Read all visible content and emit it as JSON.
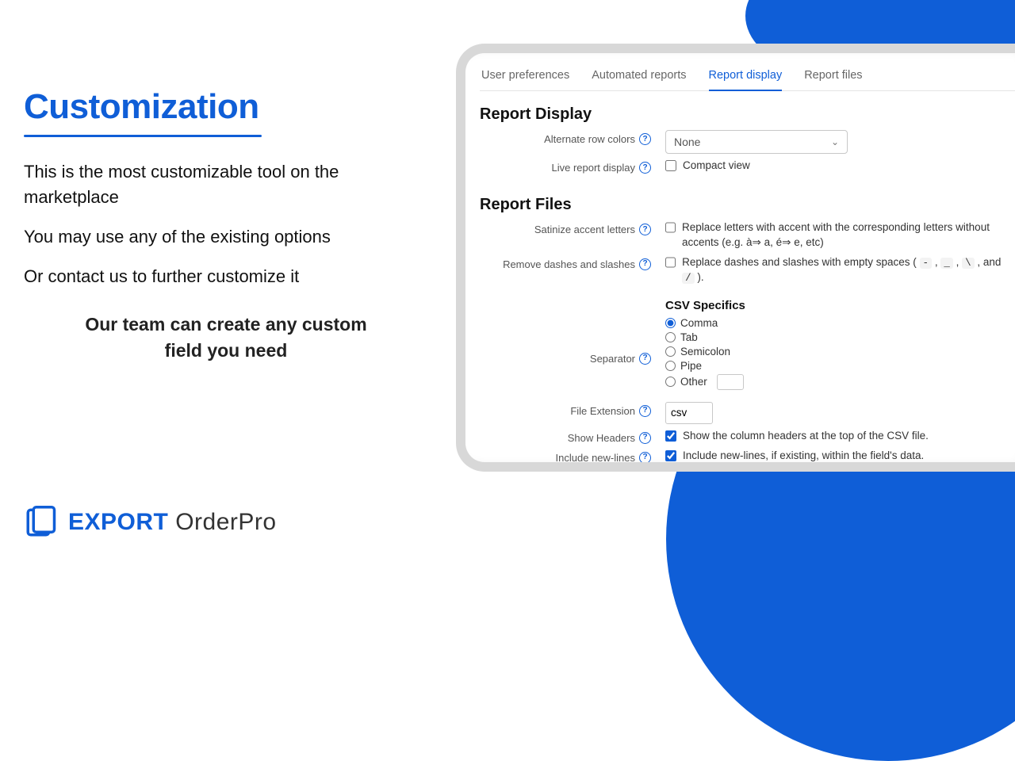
{
  "marketing": {
    "heading": "Customization",
    "p1": "This is the most customizable tool on the marketplace",
    "p2": "You may use any of the existing options",
    "p3": "Or contact us to further customize it",
    "tagline": "Our team can create any custom field you need"
  },
  "brand": {
    "bold": "EXPORT",
    "light": "OrderPro"
  },
  "tabs": [
    {
      "id": "user-prefs",
      "label": "User preferences",
      "active": false
    },
    {
      "id": "auto-reports",
      "label": "Automated reports",
      "active": false
    },
    {
      "id": "report-display",
      "label": "Report display",
      "active": true
    },
    {
      "id": "report-files",
      "label": "Report files",
      "active": false
    }
  ],
  "report_display": {
    "title": "Report Display",
    "alt_row_label": "Alternate row colors",
    "alt_row_value": "None",
    "live_label": "Live report display",
    "compact_label": "Compact view",
    "compact_checked": false
  },
  "report_files": {
    "title": "Report Files",
    "satinize_label": "Satinize accent letters",
    "satinize_desc": "Replace letters with accent with the corresponding letters without accents (e.g. à⇒ a, é⇒ e, etc)",
    "satinize_checked": false,
    "dashes_label": "Remove dashes and slashes",
    "dashes_desc_pre": "Replace dashes and slashes with empty spaces (",
    "dashes_chips": [
      "-",
      "_",
      "\\",
      "/"
    ],
    "dashes_desc_post": ").",
    "dashes_checked": false,
    "csv": {
      "title": "CSV Specifics",
      "separator_label": "Separator",
      "options": [
        "Comma",
        "Tab",
        "Semicolon",
        "Pipe",
        "Other"
      ],
      "selected": "Comma",
      "ext_label": "File Extension",
      "ext_value": "csv",
      "headers_label": "Show Headers",
      "headers_desc": "Show the column headers at the top of the CSV file.",
      "headers_checked": true,
      "newlines_label": "Include new-lines",
      "newlines_desc": "Include new-lines, if existing, within the field's data.",
      "newlines_checked": true
    }
  }
}
